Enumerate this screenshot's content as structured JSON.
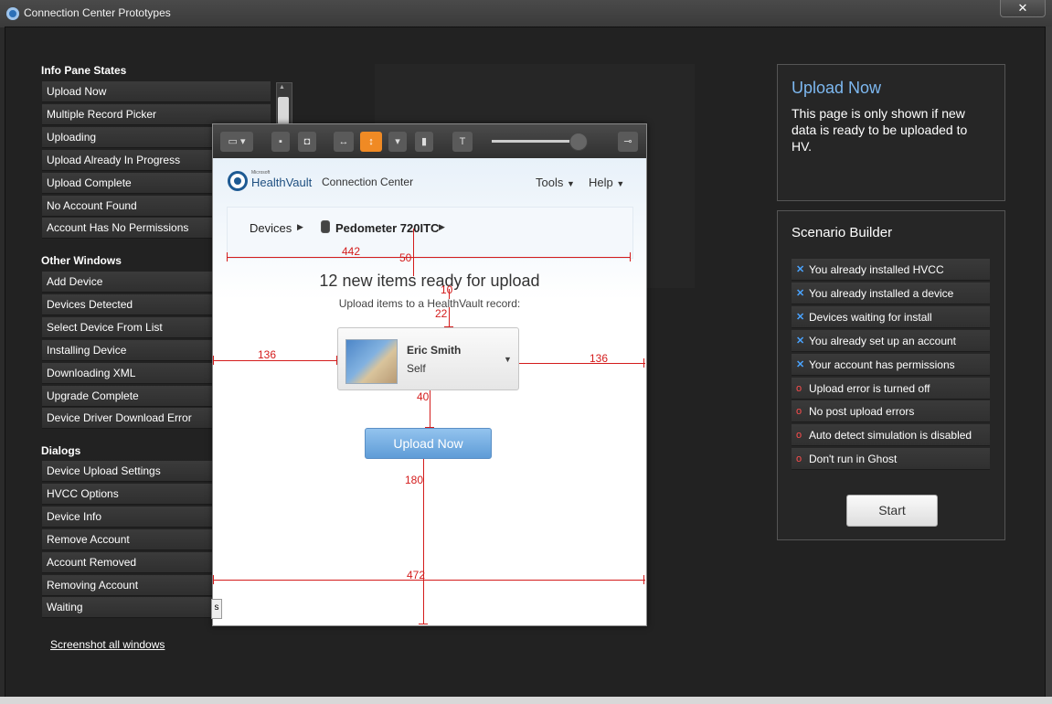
{
  "window": {
    "title": "Connection Center Prototypes",
    "close_glyph": "✕"
  },
  "left": {
    "info_pane_title": "Info Pane States",
    "info_pane_items": [
      "Upload Now",
      "Multiple Record Picker",
      "Uploading",
      "Upload Already In Progress",
      "Upload Complete",
      "No Account Found",
      "Account Has No Permissions"
    ],
    "other_windows_title": "Other Windows",
    "other_windows_items": [
      "Add Device",
      "Devices Detected",
      "Select Device From List",
      "Installing Device",
      "Downloading XML",
      "Upgrade Complete",
      "Device Driver Download Error"
    ],
    "dialogs_title": "Dialogs",
    "dialogs_items": [
      "Device Upload Settings",
      "HVCC Options",
      "Device Info",
      "Remove Account",
      "Account Removed",
      "Removing Account",
      "Waiting"
    ],
    "screenshot_link": "Screenshot all windows"
  },
  "info_panel": {
    "title": "Upload Now",
    "description": "This page is only shown if new data is ready to be uploaded to HV."
  },
  "scenario": {
    "title": "Scenario Builder",
    "items": [
      {
        "label": "You already installed HVCC",
        "marker": "x"
      },
      {
        "label": "You already installed a device",
        "marker": "x"
      },
      {
        "label": "Devices waiting for install",
        "marker": "x"
      },
      {
        "label": "You already set up an account",
        "marker": "x"
      },
      {
        "label": "Your account has permissions",
        "marker": "x"
      },
      {
        "label": "Upload error is turned off",
        "marker": "o"
      },
      {
        "label": "No post upload errors",
        "marker": "o"
      },
      {
        "label": "Auto detect simulation is disabled",
        "marker": "o"
      },
      {
        "label": "Don't run in Ghost",
        "marker": "o"
      }
    ],
    "start_label": "Start"
  },
  "dialog": {
    "brand_microsoft": "Microsoft",
    "brand_main": "HealthVault",
    "brand_sub": " Connection Center",
    "tools_menu": "Tools",
    "help_menu": "Help",
    "breadcrumb_devices": "Devices",
    "breadcrumb_device": "Pedometer 720ITC",
    "heading": "12 new items ready for upload",
    "subheading": "Upload items to a HealthVault record:",
    "record_name": "Eric Smith",
    "record_relation": "Self",
    "upload_button": "Upload Now",
    "side_tab": "s",
    "measurements": {
      "width_442": "442",
      "gap_50": "50",
      "gap_10": "10",
      "gap_22": "22",
      "left_136": "136",
      "right_136": "136",
      "gap_40": "40",
      "gap_180": "180",
      "width_472": "472"
    }
  },
  "colors": {
    "accent_blue": "#7db8f0",
    "upload_button": "#6fa8e0",
    "redline": "#d41c1c",
    "toolbar_active": "#f08a24"
  }
}
